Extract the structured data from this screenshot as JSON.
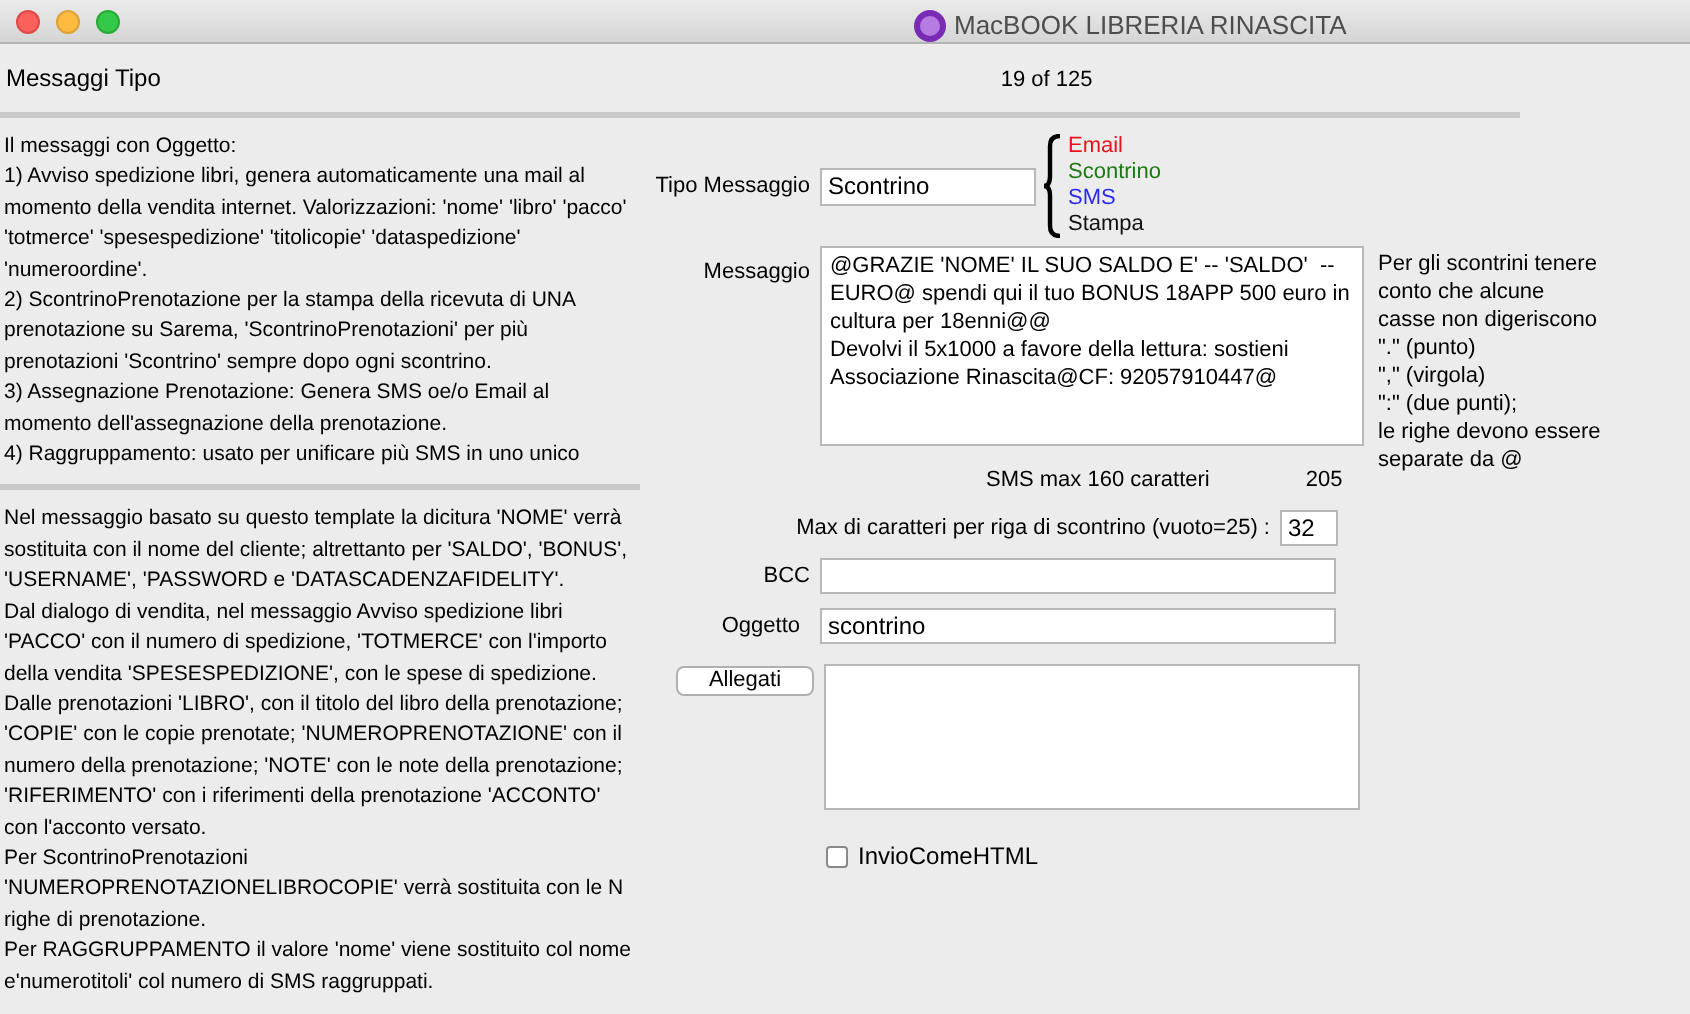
{
  "window": {
    "title": "MacBOOK LIBRERIA RINASCITA"
  },
  "header": {
    "title": "Messaggi Tipo",
    "record": "19 of 125"
  },
  "help_top": [
    "Il messaggi con Oggetto:",
    "1) Avviso spedizione libri, genera automaticamente una mail al momento della vendita internet. Valorizzazioni: 'nome' 'libro' 'pacco' 'totmerce' 'spesespedizione' 'titolicopie' 'dataspedizione' 'numeroordine'.",
    "2) ScontrinoPrenotazione per la stampa della ricevuta di UNA prenotazione su Sarema,  'ScontrinoPrenotazioni' per più prenotazioni 'Scontrino' sempre dopo ogni scontrino.",
    "3) Assegnazione Prenotazione: Genera SMS oe/o Email al momento dell'assegnazione della prenotazione.",
    "4) Raggruppamento: usato per unificare più SMS in uno unico"
  ],
  "help_bottom": [
    "Nel messaggio basato su questo template la dicitura 'NOME' verrà sostituita con il nome del cliente; altrettanto per 'SALDO', 'BONUS', 'USERNAME', 'PASSWORD  e 'DATASCADENZAFIDELITY'.",
    "Dal dialogo di vendita, nel messaggio Avviso spedizione libri 'PACCO' con il numero di spedizione, 'TOTMERCE' con l'importo della vendita 'SPESESPEDIZIONE', con le spese di spedizione.",
    "Dalle prenotazioni 'LIBRO', con il titolo del libro della prenotazione; 'COPIE' con le copie prenotate; 'NUMEROPRENOTAZIONE' con il numero della prenotazione; 'NOTE' con le note della prenotazione; 'RIFERIMENTO' con i riferimenti della prenotazione 'ACCONTO' con l'acconto versato.",
    "Per ScontrinoPrenotazioni 'NUMEROPRENOTAZIONELIBROCOPIE' verrà sostituita con le N righe di prenotazione.",
    "Per RAGGRUPPAMENTO il valore 'nome' viene sostituito col nome e'numerotitoli'  col numero di SMS raggruppati."
  ],
  "tipo": {
    "label": "Tipo Messaggio",
    "value": "Scontrino"
  },
  "types": [
    {
      "label": "Email",
      "color": "#e8121b"
    },
    {
      "label": "Scontrino",
      "color": "#1a7a12"
    },
    {
      "label": "SMS",
      "color": "#2b2bf0"
    },
    {
      "label": "Stampa",
      "color": "#111111"
    }
  ],
  "message": {
    "label": "Messaggio",
    "value": "@GRAZIE 'NOME' IL SUO SALDO E' -- 'SALDO'  -- EURO@ spendi qui il tuo BONUS 18APP 500 euro in cultura per 18enni@@\nDevolvi il 5x1000 a favore della lettura: sostieni Associazione Rinascita@CF: 92057910447@"
  },
  "note": [
    "Per gli scontrini tenere conto che alcune casse non digeriscono",
    "\".\" (punto)",
    "\",\" (virgola)",
    "\":\" (due punti);",
    "le righe devono essere separate da @"
  ],
  "sms": {
    "label": "SMS max 160 caratteri",
    "count": "205"
  },
  "max_chars": {
    "label": "Max di caratteri per riga di scontrino (vuoto=25) :",
    "value": "32"
  },
  "bcc": {
    "label": "BCC"
  },
  "oggetto": {
    "label": "Oggetto",
    "value": "scontrino"
  },
  "allegati": {
    "button": "Allegati"
  },
  "html": {
    "label": "InvioComeHTML",
    "checked": false
  }
}
